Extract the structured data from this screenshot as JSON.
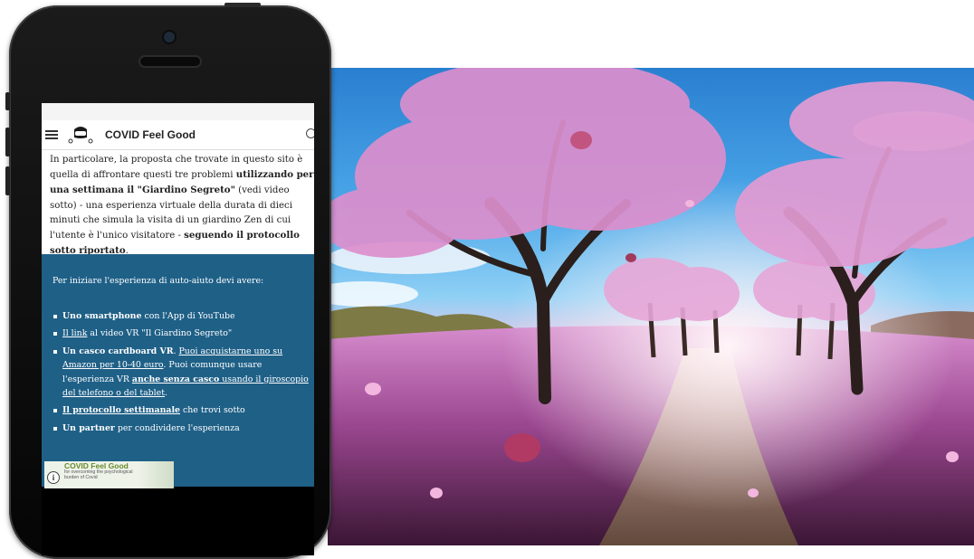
{
  "app": {
    "brand": "COVID Feel Good"
  },
  "intro_paragraph": {
    "part1": "In particolare, la proposta che trovate in questo sito è quella di affrontare questi tre problemi ",
    "bold1": "utilizzando per una settimana il \"Giardino Segreto\"",
    "part2": " (vedi video sotto) - una esperienza virtuale della durata di dieci minuti che simula la visita di un giardino Zen di cui l'utente è l'unico visitatore - ",
    "bold2": "seguendo il protocollo sotto riportato",
    "part3": "."
  },
  "requirements": {
    "intro": "Per iniziare l'esperienza di auto-aiuto devi avere:",
    "item1_bold": "Uno smartphone",
    "item1_rest": " con l'App di YouTube",
    "item2_link": "Il link",
    "item2_rest": " al video VR \"Il Giardino Segreto\"",
    "item3_bold": "Un casco cardboard VR",
    "item3_text1": ". ",
    "item3_link1": "Puoi acquistarne uno su Amazon per 10-40 euro",
    "item3_text2": ". Puoi comunque usare l'esperienza VR ",
    "item3_link2_bold": "anche senza casco",
    "item3_link2_rest": " usando il giroscopio del telefono o del tablet",
    "item3_text3": ".",
    "item4_link_bold": "Il protocollo settimanale",
    "item4_rest": " che trovi sotto",
    "item5_bold": "Un partner",
    "item5_rest": " per condividere l'esperienza"
  },
  "video_thumbnail": {
    "title": "COVID Feel Good",
    "subtitle": "for overcoming the psychological burden of Covid"
  },
  "colors": {
    "blue_panel": "#1f6087",
    "brand_green": "#6a8a2a"
  },
  "icons": [
    "menu-icon",
    "search-icon",
    "info-icon",
    "vr-headset-logo"
  ]
}
